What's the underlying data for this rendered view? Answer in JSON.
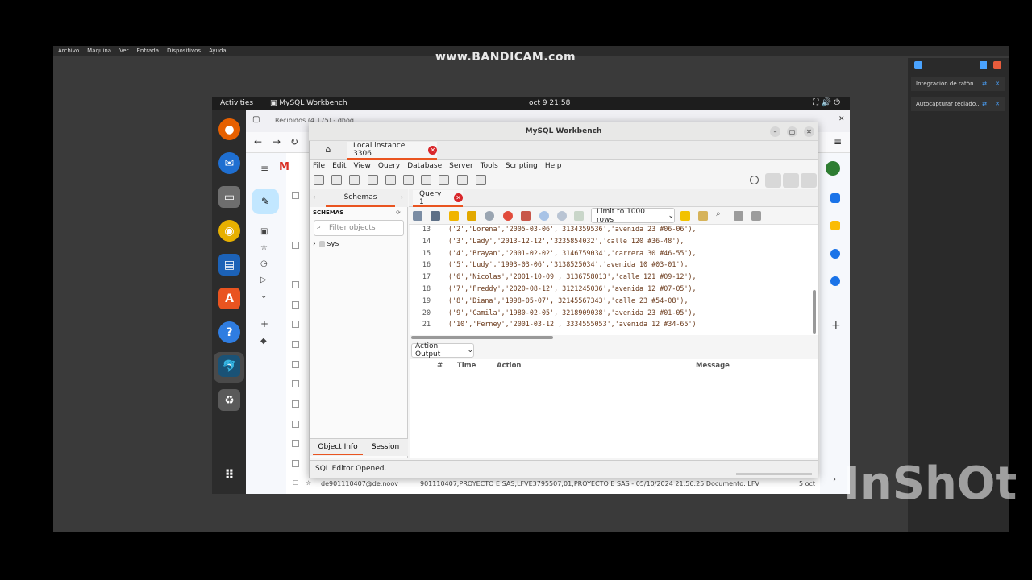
{
  "host": {
    "menu": [
      "Archivo",
      "Máquina",
      "Ver",
      "Entrada",
      "Dispositivos",
      "Ayuda"
    ],
    "watermark_top": "www.BANDICAM.com",
    "watermark_bottom": "InShOt",
    "side_panel": {
      "items": [
        "Integración de ratón...",
        "Autocapturar teclado..."
      ]
    }
  },
  "ubuntu": {
    "activities": "Activities",
    "app_name": "MySQL Workbench",
    "clock": "oct 9  21:58"
  },
  "firefox": {
    "tab_label": "Recibidos (4.175) - dhog",
    "gmail_bottom_row": {
      "sender": "de901110407@de.noov",
      "subject": "901110407;PROYECTO E SAS;LFVE3795507;01;PROYECTO E SAS - 05/10/2024 21:56:25 Documento: LFVE37...",
      "date": "5 oct"
    }
  },
  "workbench": {
    "window_title": "MySQL Workbench",
    "connection_tab": "Local instance 3306",
    "menu": [
      "File",
      "Edit",
      "View",
      "Query",
      "Database",
      "Server",
      "Tools",
      "Scripting",
      "Help"
    ],
    "navigator": {
      "tab": "Schemas",
      "header": "SCHEMAS",
      "filter_placeholder": "Filter objects",
      "schemas": [
        "sys"
      ]
    },
    "info_tabs": [
      "Object Info",
      "Session"
    ],
    "query_tab": "Query 1",
    "limit": "Limit to 1000 rows",
    "code_lines": [
      {
        "n": "13",
        "text": "('2','Lorena','2005-03-06','3134359536','avenida 23 #06-06'),"
      },
      {
        "n": "14",
        "text": "('3','Lady','2013-12-12','3235854032','calle 120 #36-48'),"
      },
      {
        "n": "15",
        "text": "('4','Brayan','2001-02-02','3146759034','carrera 30 #46-55'),"
      },
      {
        "n": "16",
        "text": "('5','Ludy','1993-03-06','3138525034','avenida 10 #03-01'),"
      },
      {
        "n": "17",
        "text": "('6','Nicolas','2001-10-09','3136758013','calle 121 #09-12'),"
      },
      {
        "n": "18",
        "text": "('7','Freddy','2020-08-12','3121245036','avenida 12 #07-05'),"
      },
      {
        "n": "19",
        "text": "('8','Diana','1998-05-07','32145567343','calle 23 #54-08'),"
      },
      {
        "n": "20",
        "text": "('9','Camila','1980-02-05','3218909038','avenida 23 #01-05'),"
      },
      {
        "n": "21",
        "text": "('10','Ferney','2001-03-12','3334555053','avenida 12 #34-65')"
      }
    ],
    "output": {
      "selector": "Action Output",
      "columns": [
        "#",
        "Time",
        "Action",
        "Message"
      ]
    },
    "status": "SQL Editor Opened."
  }
}
